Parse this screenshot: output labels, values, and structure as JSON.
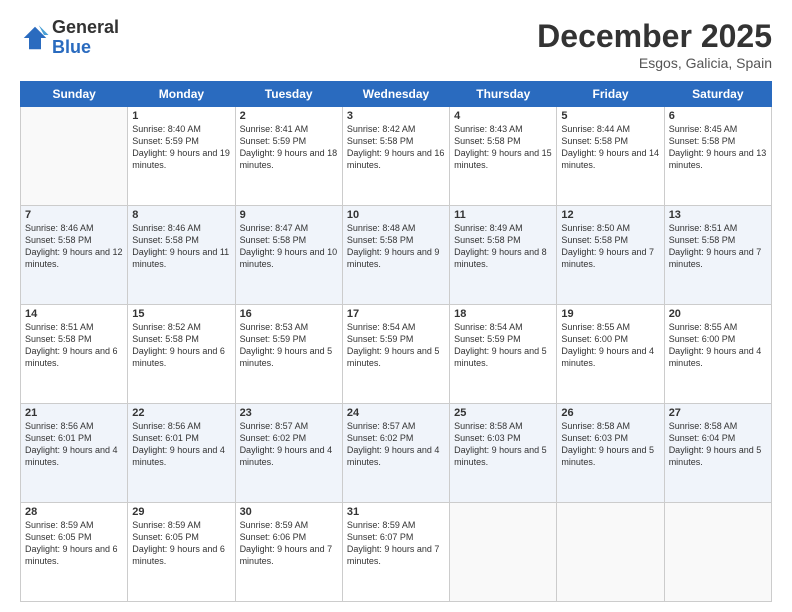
{
  "logo": {
    "general": "General",
    "blue": "Blue"
  },
  "header": {
    "month": "December 2025",
    "location": "Esgos, Galicia, Spain"
  },
  "weekdays": [
    "Sunday",
    "Monday",
    "Tuesday",
    "Wednesday",
    "Thursday",
    "Friday",
    "Saturday"
  ],
  "weeks": [
    [
      {
        "day": "",
        "info": ""
      },
      {
        "day": "1",
        "sunrise": "Sunrise: 8:40 AM",
        "sunset": "Sunset: 5:59 PM",
        "daylight": "Daylight: 9 hours and 19 minutes."
      },
      {
        "day": "2",
        "sunrise": "Sunrise: 8:41 AM",
        "sunset": "Sunset: 5:59 PM",
        "daylight": "Daylight: 9 hours and 18 minutes."
      },
      {
        "day": "3",
        "sunrise": "Sunrise: 8:42 AM",
        "sunset": "Sunset: 5:58 PM",
        "daylight": "Daylight: 9 hours and 16 minutes."
      },
      {
        "day": "4",
        "sunrise": "Sunrise: 8:43 AM",
        "sunset": "Sunset: 5:58 PM",
        "daylight": "Daylight: 9 hours and 15 minutes."
      },
      {
        "day": "5",
        "sunrise": "Sunrise: 8:44 AM",
        "sunset": "Sunset: 5:58 PM",
        "daylight": "Daylight: 9 hours and 14 minutes."
      },
      {
        "day": "6",
        "sunrise": "Sunrise: 8:45 AM",
        "sunset": "Sunset: 5:58 PM",
        "daylight": "Daylight: 9 hours and 13 minutes."
      }
    ],
    [
      {
        "day": "7",
        "sunrise": "Sunrise: 8:46 AM",
        "sunset": "Sunset: 5:58 PM",
        "daylight": "Daylight: 9 hours and 12 minutes."
      },
      {
        "day": "8",
        "sunrise": "Sunrise: 8:46 AM",
        "sunset": "Sunset: 5:58 PM",
        "daylight": "Daylight: 9 hours and 11 minutes."
      },
      {
        "day": "9",
        "sunrise": "Sunrise: 8:47 AM",
        "sunset": "Sunset: 5:58 PM",
        "daylight": "Daylight: 9 hours and 10 minutes."
      },
      {
        "day": "10",
        "sunrise": "Sunrise: 8:48 AM",
        "sunset": "Sunset: 5:58 PM",
        "daylight": "Daylight: 9 hours and 9 minutes."
      },
      {
        "day": "11",
        "sunrise": "Sunrise: 8:49 AM",
        "sunset": "Sunset: 5:58 PM",
        "daylight": "Daylight: 9 hours and 8 minutes."
      },
      {
        "day": "12",
        "sunrise": "Sunrise: 8:50 AM",
        "sunset": "Sunset: 5:58 PM",
        "daylight": "Daylight: 9 hours and 7 minutes."
      },
      {
        "day": "13",
        "sunrise": "Sunrise: 8:51 AM",
        "sunset": "Sunset: 5:58 PM",
        "daylight": "Daylight: 9 hours and 7 minutes."
      }
    ],
    [
      {
        "day": "14",
        "sunrise": "Sunrise: 8:51 AM",
        "sunset": "Sunset: 5:58 PM",
        "daylight": "Daylight: 9 hours and 6 minutes."
      },
      {
        "day": "15",
        "sunrise": "Sunrise: 8:52 AM",
        "sunset": "Sunset: 5:58 PM",
        "daylight": "Daylight: 9 hours and 6 minutes."
      },
      {
        "day": "16",
        "sunrise": "Sunrise: 8:53 AM",
        "sunset": "Sunset: 5:59 PM",
        "daylight": "Daylight: 9 hours and 5 minutes."
      },
      {
        "day": "17",
        "sunrise": "Sunrise: 8:54 AM",
        "sunset": "Sunset: 5:59 PM",
        "daylight": "Daylight: 9 hours and 5 minutes."
      },
      {
        "day": "18",
        "sunrise": "Sunrise: 8:54 AM",
        "sunset": "Sunset: 5:59 PM",
        "daylight": "Daylight: 9 hours and 5 minutes."
      },
      {
        "day": "19",
        "sunrise": "Sunrise: 8:55 AM",
        "sunset": "Sunset: 6:00 PM",
        "daylight": "Daylight: 9 hours and 4 minutes."
      },
      {
        "day": "20",
        "sunrise": "Sunrise: 8:55 AM",
        "sunset": "Sunset: 6:00 PM",
        "daylight": "Daylight: 9 hours and 4 minutes."
      }
    ],
    [
      {
        "day": "21",
        "sunrise": "Sunrise: 8:56 AM",
        "sunset": "Sunset: 6:01 PM",
        "daylight": "Daylight: 9 hours and 4 minutes."
      },
      {
        "day": "22",
        "sunrise": "Sunrise: 8:56 AM",
        "sunset": "Sunset: 6:01 PM",
        "daylight": "Daylight: 9 hours and 4 minutes."
      },
      {
        "day": "23",
        "sunrise": "Sunrise: 8:57 AM",
        "sunset": "Sunset: 6:02 PM",
        "daylight": "Daylight: 9 hours and 4 minutes."
      },
      {
        "day": "24",
        "sunrise": "Sunrise: 8:57 AM",
        "sunset": "Sunset: 6:02 PM",
        "daylight": "Daylight: 9 hours and 4 minutes."
      },
      {
        "day": "25",
        "sunrise": "Sunrise: 8:58 AM",
        "sunset": "Sunset: 6:03 PM",
        "daylight": "Daylight: 9 hours and 5 minutes."
      },
      {
        "day": "26",
        "sunrise": "Sunrise: 8:58 AM",
        "sunset": "Sunset: 6:03 PM",
        "daylight": "Daylight: 9 hours and 5 minutes."
      },
      {
        "day": "27",
        "sunrise": "Sunrise: 8:58 AM",
        "sunset": "Sunset: 6:04 PM",
        "daylight": "Daylight: 9 hours and 5 minutes."
      }
    ],
    [
      {
        "day": "28",
        "sunrise": "Sunrise: 8:59 AM",
        "sunset": "Sunset: 6:05 PM",
        "daylight": "Daylight: 9 hours and 6 minutes."
      },
      {
        "day": "29",
        "sunrise": "Sunrise: 8:59 AM",
        "sunset": "Sunset: 6:05 PM",
        "daylight": "Daylight: 9 hours and 6 minutes."
      },
      {
        "day": "30",
        "sunrise": "Sunrise: 8:59 AM",
        "sunset": "Sunset: 6:06 PM",
        "daylight": "Daylight: 9 hours and 7 minutes."
      },
      {
        "day": "31",
        "sunrise": "Sunrise: 8:59 AM",
        "sunset": "Sunset: 6:07 PM",
        "daylight": "Daylight: 9 hours and 7 minutes."
      },
      {
        "day": "",
        "info": ""
      },
      {
        "day": "",
        "info": ""
      },
      {
        "day": "",
        "info": ""
      }
    ]
  ]
}
